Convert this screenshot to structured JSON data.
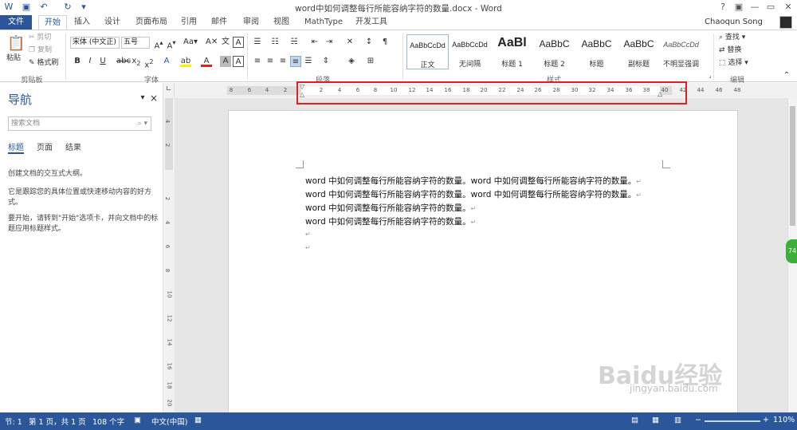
{
  "window": {
    "title": "word中如何调整每行所能容纳字符的数量.docx - Word",
    "help": "?",
    "minimize": "—",
    "restore": "▭",
    "close": "✕"
  },
  "tabs": [
    {
      "label": "文件"
    },
    {
      "label": "开始"
    },
    {
      "label": "插入"
    },
    {
      "label": "设计"
    },
    {
      "label": "页面布局"
    },
    {
      "label": "引用"
    },
    {
      "label": "邮件"
    },
    {
      "label": "审阅"
    },
    {
      "label": "视图"
    },
    {
      "label": "MathType"
    },
    {
      "label": "开发工具"
    }
  ],
  "user": {
    "name": "Chaoqun Song"
  },
  "ribbon": {
    "clipboard": {
      "paste": "粘贴",
      "cut": "剪切",
      "copy": "复制",
      "format_painter": "格式刷",
      "group": "剪贴板"
    },
    "font": {
      "name": "宋体 (中文正)",
      "size": "五号",
      "group": "字体"
    },
    "paragraph": {
      "group": "段落"
    },
    "styles": {
      "group": "样式",
      "items": [
        {
          "sample": "AaBbCcDd",
          "name": "正文"
        },
        {
          "sample": "AaBbCcDd",
          "name": "无间隔"
        },
        {
          "sample": "AaBl",
          "name": "标题 1"
        },
        {
          "sample": "AaBbC",
          "name": "标题 2"
        },
        {
          "sample": "AaBbC",
          "name": "标题"
        },
        {
          "sample": "AaBbC",
          "name": "副标题"
        },
        {
          "sample": "AaBbCcDd",
          "name": "不明显强调"
        }
      ]
    },
    "editing": {
      "find": "查找",
      "replace": "替换",
      "select": "选择",
      "group": "编辑"
    }
  },
  "nav": {
    "title": "导航",
    "search_placeholder": "搜索文档",
    "tabs": [
      "标题",
      "页面",
      "结果"
    ],
    "text1": "创建文档的交互式大纲。",
    "text2": "它是跟踪您的具体位置或快速移动内容的好方式。",
    "text3": "要开始，请转到\"开始\"选项卡，并向文档中的标题应用标题样式。"
  },
  "ruler": {
    "left_numbers": [
      "8",
      "6",
      "4",
      "2"
    ],
    "numbers": [
      "2",
      "4",
      "6",
      "8",
      "10",
      "12",
      "14",
      "16",
      "18",
      "20",
      "22",
      "24",
      "26",
      "28",
      "30",
      "32",
      "34",
      "36",
      "38",
      "40",
      "42",
      "44",
      "46",
      "48"
    ],
    "vertical": [
      "4",
      "2",
      "2",
      "4",
      "6",
      "8",
      "10",
      "12",
      "14",
      "16",
      "18",
      "20"
    ]
  },
  "document": {
    "lines": [
      "word 中如何调整每行所能容纳字符的数量。word 中如何调整每行所能容纳字符的数量。",
      "word 中如何调整每行所能容纳字符的数量。word 中如何调整每行所能容纳字符的数量。",
      "word 中如何调整每行所能容纳字符的数量。",
      "word 中如何调整每行所能容纳字符的数量。",
      "",
      ""
    ],
    "para_mark": "↵"
  },
  "status": {
    "section": "节: 1",
    "page": "第 1 页，共 1 页",
    "words": "108 个字",
    "language": "中文(中国)",
    "zoom": "110%"
  },
  "watermark": {
    "text": "Baidu经验",
    "url": "jingyan.baidu.com"
  },
  "badge": "74",
  "colors": {
    "accent": "#2b579a",
    "highlight": "#e02020"
  }
}
